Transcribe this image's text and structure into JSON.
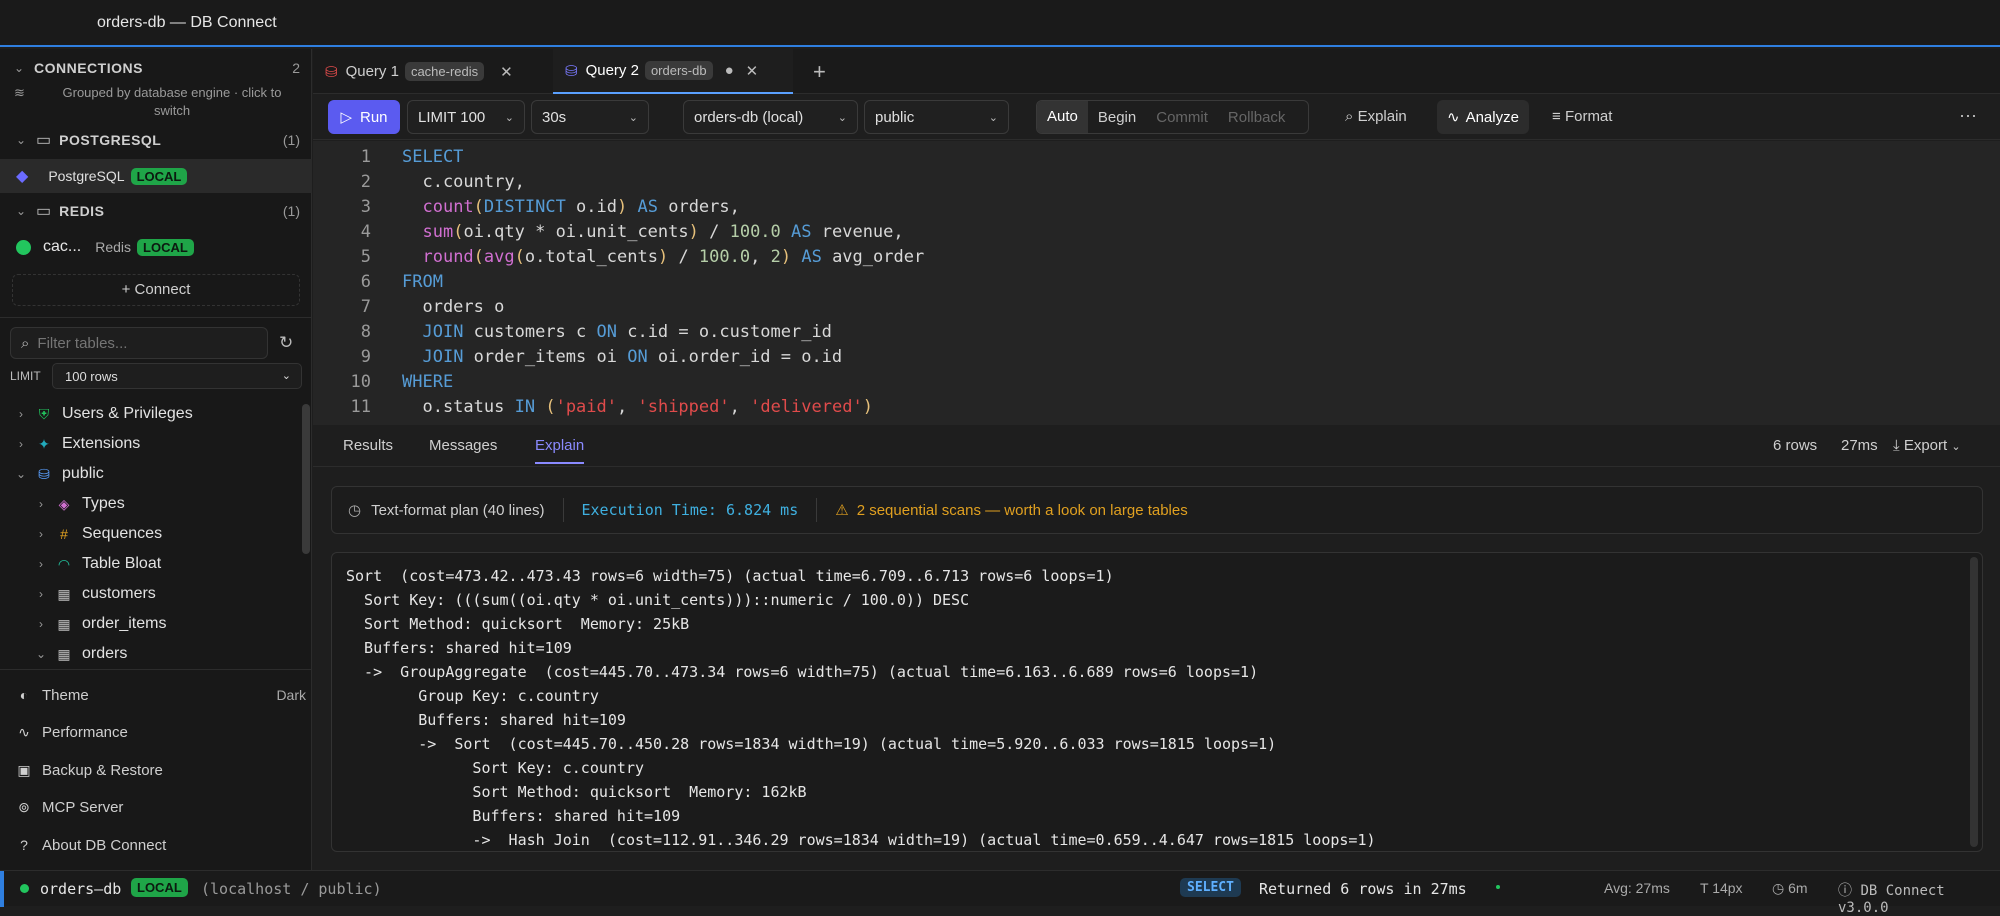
{
  "window": {
    "title": "orders-db — DB Connect"
  },
  "sidebar": {
    "connections_label": "CONNECTIONS",
    "connections_count": "2",
    "grouped_hint_line1": "Grouped by database engine · click to",
    "grouped_hint_line2": "switch",
    "groups": [
      {
        "name": "POSTGRESQL",
        "count": "(1)",
        "item": {
          "name": "PostgreSQL",
          "badge": "LOCAL"
        }
      },
      {
        "name": "REDIS",
        "count": "(1)",
        "item": {
          "name": "cac...",
          "engine": "Redis",
          "badge": "LOCAL"
        }
      }
    ],
    "connect_label": "+ Connect",
    "filter_placeholder": "Filter tables...",
    "limit_label": "LIMIT",
    "limit_value": "100 rows",
    "tree": [
      "Users & Privileges",
      "Extensions",
      "public",
      "Types",
      "Sequences",
      "Table Bloat",
      "customers",
      "order_items",
      "orders"
    ],
    "footer": [
      {
        "label": "Theme",
        "value": "Dark"
      },
      {
        "label": "Performance"
      },
      {
        "label": "Backup & Restore"
      },
      {
        "label": "MCP Server"
      },
      {
        "label": "About DB Connect"
      }
    ]
  },
  "tabs": [
    {
      "label": "Query 1",
      "pill": "cache-redis"
    },
    {
      "label": "Query 2",
      "pill": "orders-db"
    }
  ],
  "toolbar": {
    "run": "Run",
    "limit": "LIMIT 100",
    "timeout": "30s",
    "database": "orders-db (local)",
    "schema": "public",
    "tx": [
      "Auto",
      "Begin",
      "Commit",
      "Rollback"
    ],
    "explain": "Explain",
    "analyze": "Analyze",
    "format": "Format"
  },
  "results": {
    "tabs": [
      "Results",
      "Messages",
      "Explain"
    ],
    "rows": "6 rows",
    "time": "27ms",
    "export": "Export",
    "plan_summary": "Text-format plan (40 lines)",
    "exec_time": "Execution Time: 6.824 ms",
    "warning": "2 sequential scans — worth a look on large tables",
    "plan_lines": [
      "Sort  (cost=473.42..473.43 rows=6 width=75) (actual time=6.709..6.713 rows=6 loops=1)",
      "  Sort Key: (((sum((oi.qty * oi.unit_cents)))::numeric / 100.0)) DESC",
      "  Sort Method: quicksort  Memory: 25kB",
      "  Buffers: shared hit=109",
      "  ->  GroupAggregate  (cost=445.70..473.34 rows=6 width=75) (actual time=6.163..6.689 rows=6 loops=1)",
      "        Group Key: c.country",
      "        Buffers: shared hit=109",
      "        ->  Sort  (cost=445.70..450.28 rows=1834 width=19) (actual time=5.920..6.033 rows=1815 loops=1)",
      "              Sort Key: c.country",
      "              Sort Method: quicksort  Memory: 162kB",
      "              Buffers: shared hit=109",
      "              ->  Hash Join  (cost=112.91..346.29 rows=1834 width=19) (actual time=0.659..4.647 rows=1815 loops=1)"
    ]
  },
  "status": {
    "conn": "orders–db",
    "badge": "LOCAL",
    "host": "(localhost / public)",
    "stmt": "SELECT",
    "returned": "Returned 6 rows in 27ms",
    "avg": "Avg: 27ms",
    "font": "14px",
    "age": "6m",
    "version": "DB Connect v3.0.0"
  }
}
